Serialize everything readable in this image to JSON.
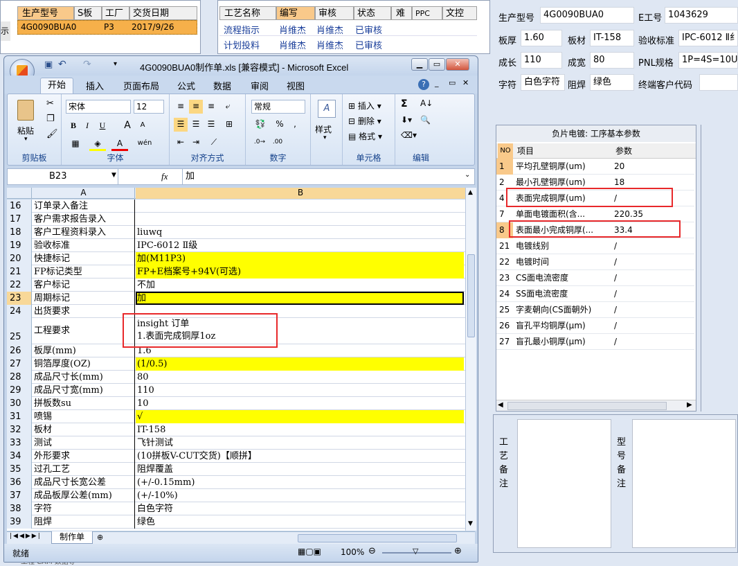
{
  "top_left": {
    "left_edge": "示",
    "headers": [
      "生产型号",
      "S板",
      "工厂",
      "交货日期"
    ],
    "row": [
      "4G0090BUA0",
      "",
      "P3",
      "2017/9/26"
    ]
  },
  "top_mid": {
    "headers": [
      "工艺名称",
      "编写",
      "审核",
      "状态",
      "难",
      "PPC",
      "文控"
    ],
    "rows": [
      [
        "流程指示",
        "肖维杰",
        "肖维杰",
        "已审核"
      ],
      [
        "计划投料",
        "肖维杰",
        "肖维杰",
        "已审核"
      ]
    ]
  },
  "excel": {
    "title": "4G0090BUA0制作单.xls  [兼容模式] - Microsoft Excel",
    "tabs": [
      "开始",
      "插入",
      "页面布局",
      "公式",
      "数据",
      "审阅",
      "视图"
    ],
    "ribbon": {
      "clipboard": {
        "label": "剪贴板",
        "paste": "粘贴"
      },
      "font": {
        "label": "字体",
        "name": "宋体",
        "size": "12",
        "bold": "B",
        "italic": "I",
        "underline": "U",
        "grow": "A",
        "shrink": "A",
        "wen": "wén"
      },
      "align": {
        "label": "对齐方式"
      },
      "number": {
        "label": "数字",
        "format": "常规",
        "pct": "%",
        "comma": ","
      },
      "styles": {
        "label": "样式"
      },
      "cells": {
        "label": "单元格",
        "insert": "插入",
        "delete": "删除",
        "format": "格式"
      },
      "edit": {
        "label": "编辑",
        "sigma": "Σ"
      }
    },
    "name_box": "B23",
    "fx": "fx",
    "formula": "加",
    "col_a": "A",
    "col_b": "B",
    "rows": [
      {
        "n": "16",
        "a": "订单录入备注",
        "b": "",
        "y": false
      },
      {
        "n": "17",
        "a": "客户需求报告录入",
        "b": "",
        "y": false
      },
      {
        "n": "18",
        "a": "客户工程资料录入",
        "b": "liuwq",
        "y": false
      },
      {
        "n": "19",
        "a": "验收标准",
        "b": "IPC-6012 Ⅱ级",
        "y": false
      },
      {
        "n": "20",
        "a": "快捷标记",
        "b": "加(M11P3)",
        "y": true
      },
      {
        "n": "21",
        "a": "FP标记类型",
        "b": "FP+E档案号+94V(可选)",
        "y": true
      },
      {
        "n": "22",
        "a": "客户标记",
        "b": "不加",
        "y": false
      },
      {
        "n": "23",
        "a": "周期标记",
        "b": "加",
        "y": true
      },
      {
        "n": "24",
        "a": "出货要求",
        "b": "",
        "y": false
      },
      {
        "n": "25",
        "a": "工程要求",
        "b": "insight 订单",
        "b2": "1.表面完成铜厚1oz",
        "y": false
      },
      {
        "n": "26",
        "a": "板厚(mm)",
        "b": "1.6",
        "y": false
      },
      {
        "n": "27",
        "a": "铜箔厚度(OZ)",
        "b": "(1/0.5)",
        "y": true
      },
      {
        "n": "28",
        "a": "成品尺寸长(mm)",
        "b": "80",
        "y": false
      },
      {
        "n": "29",
        "a": "成品尺寸宽(mm)",
        "b": "110",
        "y": false
      },
      {
        "n": "30",
        "a": "拼板数su",
        "b": "10",
        "y": false
      },
      {
        "n": "31",
        "a": "喷锡",
        "b": "√",
        "y": true
      },
      {
        "n": "32",
        "a": "板材",
        "b": "IT-158",
        "y": false
      },
      {
        "n": "33",
        "a": "测试",
        "b": "飞针测试",
        "y": false
      },
      {
        "n": "34",
        "a": "外形要求",
        "b": "(10拼板V-CUT交货)【顺拼】",
        "y": false
      },
      {
        "n": "35",
        "a": "过孔工艺",
        "b": "阻焊覆盖",
        "y": false
      },
      {
        "n": "36",
        "a": "成品尺寸长宽公差",
        "b": "(+/-0.15mm)",
        "y": false
      },
      {
        "n": "37",
        "a": "成品板厚公差(mm)",
        "b": "(+/-10%)",
        "y": false
      },
      {
        "n": "38",
        "a": "字符",
        "b": "白色字符",
        "y": false
      },
      {
        "n": "39",
        "a": "阻焊",
        "b": "绿色",
        "y": false
      }
    ],
    "sheet_tab": "制作单",
    "status": "就绪",
    "zoom": "100%"
  },
  "right": {
    "fields": {
      "model_l": "生产型号",
      "model_v": "4G0090BUA0",
      "eno_l": "E工号",
      "eno_v": "1043629",
      "thick_l": "板厚",
      "thick_v": "1.60",
      "mat_l": "板材",
      "mat_v": "IT-158",
      "std_l": "验收标准",
      "std_v": "IPC-6012 Ⅱ纟",
      "len_l": "成长",
      "len_v": "110",
      "wid_l": "成宽",
      "wid_v": "80",
      "pnl_l": "PNL规格",
      "pnl_v": "1P=4S=10U",
      "char_l": "字符",
      "char_v": "白色字符",
      "mask_l": "阻焊",
      "mask_v": "绿色",
      "cust_l": "终端客户代码",
      "cust_v": ""
    },
    "params": {
      "title": "负片电镀: 工序基本参数",
      "h_no": "NO",
      "h_item": "项目",
      "h_param": "参数",
      "rows": [
        {
          "no": "1",
          "item": "平均孔壁铜厚(um)",
          "p": "20",
          "hl": true
        },
        {
          "no": "2",
          "item": "最小孔壁铜厚(um)",
          "p": "18",
          "hl": false
        },
        {
          "no": "4",
          "item": "表面完成铜厚(um)",
          "p": "/",
          "hl": false
        },
        {
          "no": "7",
          "item": "单面电镀面积(含...",
          "p": "220.35",
          "hl": false
        },
        {
          "no": "8",
          "item": "表面最小完成铜厚(...",
          "p": "33.4",
          "hl": true
        },
        {
          "no": "21",
          "item": "电镀线别",
          "p": "/",
          "hl": false
        },
        {
          "no": "22",
          "item": "电镀时间",
          "p": "/",
          "hl": false
        },
        {
          "no": "23",
          "item": "CS面电流密度",
          "p": "/",
          "hl": false
        },
        {
          "no": "24",
          "item": "SS面电流密度",
          "p": "/",
          "hl": false
        },
        {
          "no": "25",
          "item": "字麦朝向(CS面朝外)",
          "p": "/",
          "hl": false
        },
        {
          "no": "26",
          "item": "盲孔平均铜厚(μm)",
          "p": "/",
          "hl": false
        },
        {
          "no": "27",
          "item": "盲孔最小铜厚(μm)",
          "p": "/",
          "hl": false
        }
      ]
    },
    "note1": [
      "工",
      "艺",
      "备",
      "注"
    ],
    "note2": [
      "型",
      "号",
      "备",
      "注"
    ]
  },
  "bottom_strip": "工程    CAM    数据等"
}
